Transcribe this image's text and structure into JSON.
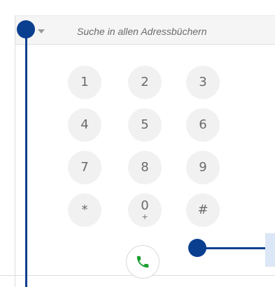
{
  "search": {
    "placeholder": "Suche in allen Adressbüchern",
    "dropdown_icon": "caret-down-icon"
  },
  "keypad": {
    "keys": [
      {
        "label": "1",
        "sub": ""
      },
      {
        "label": "2",
        "sub": ""
      },
      {
        "label": "3",
        "sub": ""
      },
      {
        "label": "4",
        "sub": ""
      },
      {
        "label": "5",
        "sub": ""
      },
      {
        "label": "6",
        "sub": ""
      },
      {
        "label": "7",
        "sub": ""
      },
      {
        "label": "8",
        "sub": ""
      },
      {
        "label": "9",
        "sub": ""
      },
      {
        "label": "*",
        "sub": ""
      },
      {
        "label": "0",
        "sub": "+"
      },
      {
        "label": "#",
        "sub": ""
      }
    ]
  },
  "call": {
    "icon": "phone-icon",
    "color": "#1a9e2e"
  },
  "colors": {
    "callout": "#0a3f8f",
    "callout_target": "#dbe6f6"
  }
}
